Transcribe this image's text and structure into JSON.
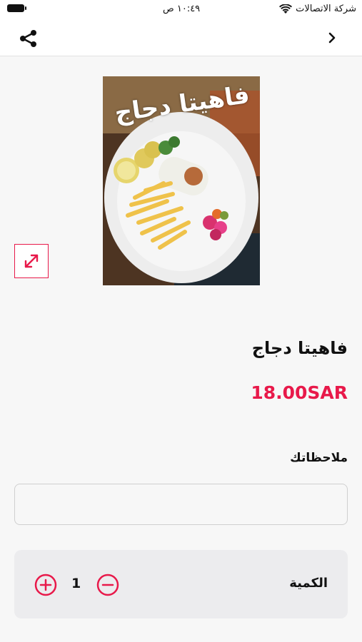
{
  "status_bar": {
    "carrier": "شركة الاتصالات",
    "time": "١٠:٤٩ ص"
  },
  "nav": {
    "share_icon": "share-icon",
    "back_icon": "chevron-right-icon"
  },
  "product": {
    "name": "فاهيتا دجاج",
    "price": "18.00SAR",
    "image_caption": "فاهيتا دجاج"
  },
  "notes": {
    "label": "ملاحظاتك",
    "value": "",
    "placeholder": ""
  },
  "quantity": {
    "label": "الكمية",
    "value": "1"
  },
  "colors": {
    "accent": "#e8194a",
    "background": "#f7f7f7",
    "panel": "#ececee"
  }
}
